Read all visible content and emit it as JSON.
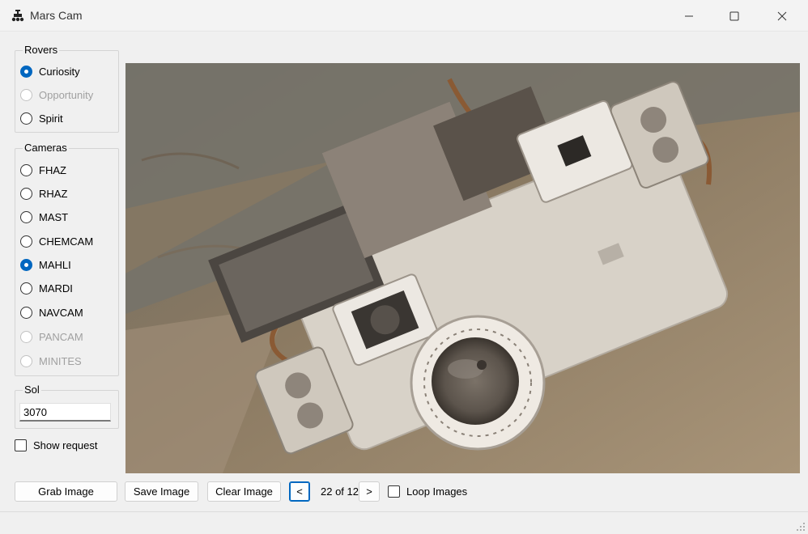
{
  "window": {
    "title": "Mars Cam"
  },
  "rovers": {
    "label": "Rovers",
    "options": [
      {
        "label": "Curiosity",
        "checked": true,
        "enabled": true
      },
      {
        "label": "Opportunity",
        "checked": false,
        "enabled": false
      },
      {
        "label": "Spirit",
        "checked": false,
        "enabled": true
      }
    ]
  },
  "cameras": {
    "label": "Cameras",
    "options": [
      {
        "label": "FHAZ",
        "checked": false,
        "enabled": true
      },
      {
        "label": "RHAZ",
        "checked": false,
        "enabled": true
      },
      {
        "label": "MAST",
        "checked": false,
        "enabled": true
      },
      {
        "label": "CHEMCAM",
        "checked": false,
        "enabled": true
      },
      {
        "label": "MAHLI",
        "checked": true,
        "enabled": true
      },
      {
        "label": "MARDI",
        "checked": false,
        "enabled": true
      },
      {
        "label": "NAVCAM",
        "checked": false,
        "enabled": true
      },
      {
        "label": "PANCAM",
        "checked": false,
        "enabled": false
      },
      {
        "label": "MINITES",
        "checked": false,
        "enabled": false
      }
    ]
  },
  "sol": {
    "label": "Sol",
    "value": "3070"
  },
  "show_request": {
    "label": "Show request",
    "checked": false
  },
  "toolbar": {
    "grab_label": "Grab Image",
    "save_label": "Save Image",
    "clear_label": "Clear Image",
    "prev_label": "<",
    "counter_text": "22 of 12",
    "next_label": ">",
    "loop_label": "Loop Images"
  },
  "image": {
    "icon": "rover-photo"
  },
  "colors": {
    "accent": "#0067c0",
    "disabled_text": "#a0a0a0"
  }
}
